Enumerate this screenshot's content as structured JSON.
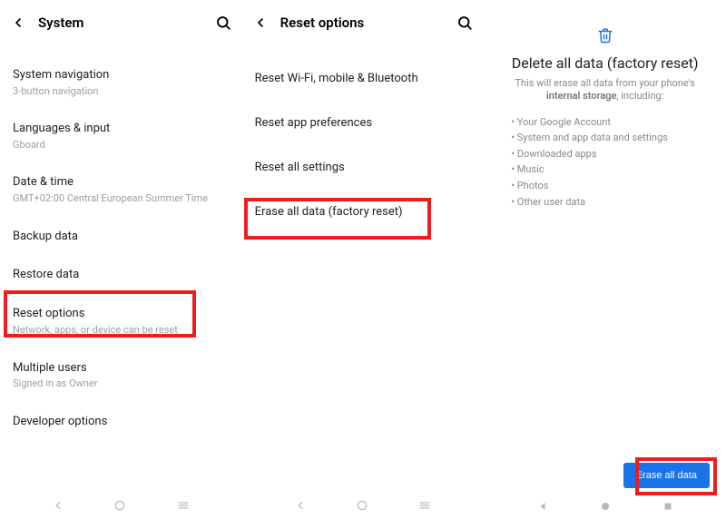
{
  "panel1": {
    "title": "System",
    "items": [
      {
        "title": "System navigation",
        "sub": "3-button navigation"
      },
      {
        "title": "Languages & input",
        "sub": "Gboard"
      },
      {
        "title": "Date & time",
        "sub": "GMT+02:00 Central European Summer Time"
      },
      {
        "title": "Backup data",
        "sub": ""
      },
      {
        "title": "Restore data",
        "sub": ""
      },
      {
        "title": "Reset options",
        "sub": "Network, apps, or device can be reset"
      },
      {
        "title": "Multiple users",
        "sub": "Signed in as Owner"
      },
      {
        "title": "Developer options",
        "sub": ""
      }
    ]
  },
  "panel2": {
    "title": "Reset options",
    "items": [
      "Reset Wi-Fi, mobile & Bluetooth",
      "Reset app preferences",
      "Reset all settings",
      "Erase all data (factory reset)"
    ]
  },
  "panel3": {
    "title": "Delete all data (factory reset)",
    "desc_pre": "This will erase all data from your phone's ",
    "desc_bold": "internal storage",
    "desc_post": ", including:",
    "bullets": [
      "Your Google Account",
      "System and app data and settings",
      "Downloaded apps",
      "Music",
      "Photos",
      "Other user data"
    ],
    "button": "Erase all data"
  }
}
